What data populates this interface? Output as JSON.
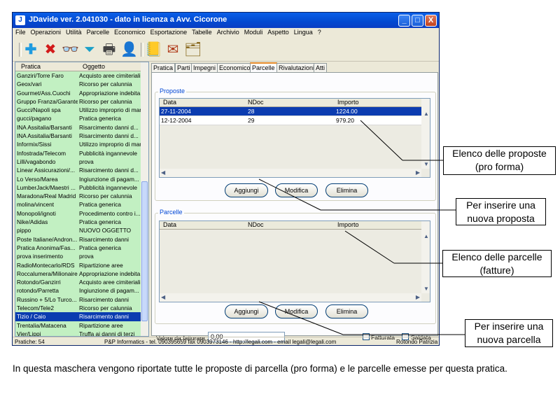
{
  "window": {
    "title": "JDavide ver. 2.041030 - dato in licenza a Avv. Cicorone",
    "app_icon": "J",
    "minimize_glyph": "_",
    "maximize_glyph": "□",
    "close_glyph": "X"
  },
  "menu": [
    "File",
    "Operazioni",
    "Utilità",
    "Parcelle",
    "Economico",
    "Esportazione",
    "Tabelle",
    "Archivio",
    "Moduli",
    "Aspetto",
    "Lingua",
    "?"
  ],
  "toolbar": {
    "icons": [
      "add-icon",
      "delete-icon",
      "search-binoculars-icon",
      "filter-icon",
      "print-icon",
      "help-icon",
      "book-icon",
      "letter-icon",
      "documents-icon"
    ],
    "glyphs": {
      "add": "✚",
      "delete": "✖",
      "binoculars": "👓",
      "filter": "⏷",
      "print": "🖶",
      "help": "👤",
      "book": "📒",
      "letter": "✉",
      "docs": "🗂"
    }
  },
  "list": {
    "headers": {
      "pratica": "Pratica",
      "oggetto": "Oggetto"
    },
    "rows": [
      {
        "pratica": "Ganziri/Torre Faro",
        "oggetto": "Acquisto aree cimiteriali"
      },
      {
        "pratica": "Geox/vari",
        "oggetto": "Ricorso per calunnia"
      },
      {
        "pratica": "Gourmet/Ass.Cuochi",
        "oggetto": "Appropriazione indebita"
      },
      {
        "pratica": "Gruppo Franza/Garante",
        "oggetto": "Ricorso per calunnia"
      },
      {
        "pratica": "Gucci/Napoli spa",
        "oggetto": "Utilizzo improprio di mar..."
      },
      {
        "pratica": "gucci/pagano",
        "oggetto": "Pratica generica"
      },
      {
        "pratica": "INA Assitalia/Barsanti",
        "oggetto": "Risarcimento danni d..."
      },
      {
        "pratica": "INA Assitalia/Barsanti",
        "oggetto": "Risarcimento danni d..."
      },
      {
        "pratica": "Informix/Sissi",
        "oggetto": "Utilizzo improprio di mar..."
      },
      {
        "pratica": "Infostrada/Telecom",
        "oggetto": "Pubblicità ingannevole"
      },
      {
        "pratica": "Lilli/vagabondo",
        "oggetto": "prova"
      },
      {
        "pratica": "Linear Assicurazioni/...",
        "oggetto": "Risarcimento danni d..."
      },
      {
        "pratica": "Lo Verso/Marea",
        "oggetto": "Ingiunzione di pagam..."
      },
      {
        "pratica": "LumberJack/Maestri ...",
        "oggetto": "Pubblicità ingannevole"
      },
      {
        "pratica": "Maradona/Real Madrid",
        "oggetto": "Ricorso per calunnia"
      },
      {
        "pratica": "molina/vincent",
        "oggetto": "Pratica generica"
      },
      {
        "pratica": "Monopoli/ignoti",
        "oggetto": "Procedimento contro i..."
      },
      {
        "pratica": "Nike/Adidas",
        "oggetto": "Pratica generica"
      },
      {
        "pratica": "pippo",
        "oggetto": "NUOVO OGGETTO"
      },
      {
        "pratica": "Poste Italiane/Andron...",
        "oggetto": "Risarcimento danni"
      },
      {
        "pratica": "Pratica Anonima/Fas...",
        "oggetto": "Pratica generica"
      },
      {
        "pratica": "prova inserimento",
        "oggetto": "prova"
      },
      {
        "pratica": "RadioMontecarlo/RDS",
        "oggetto": "Ripartizione aree"
      },
      {
        "pratica": "Roccalumera/Milionaire",
        "oggetto": "Appropriazione indebita"
      },
      {
        "pratica": "Rotondo/Ganzirri",
        "oggetto": "Acquisto aree cimiteriali"
      },
      {
        "pratica": "rotondo/Parretta",
        "oggetto": "Ingiunzione di pagam..."
      },
      {
        "pratica": "Russino + 5/Lo Turco...",
        "oggetto": "Risarcimento danni"
      },
      {
        "pratica": "Telecom/Tele2",
        "oggetto": "Ricorso per calunnia"
      },
      {
        "pratica": "Tizio / Caio",
        "oggetto": "Risarcimento danni"
      },
      {
        "pratica": "Trentalia/Matacena",
        "oggetto": "Ripartizione aree"
      },
      {
        "pratica": "Vier/Lippi",
        "oggetto": "Truffa ai danni di terzi"
      }
    ],
    "selected_index": 28
  },
  "tabs": [
    "Pratica",
    "Parti",
    "Impegni",
    "Economico",
    "Parcelle",
    "Rivalutazioni",
    "Atti"
  ],
  "active_tab": "Parcelle",
  "proposte": {
    "label": "Proposte",
    "headers": {
      "data": "Data",
      "ndoc": "NDoc",
      "importo": "Importo"
    },
    "rows": [
      {
        "data": "27-11-2004",
        "ndoc": "28",
        "importo": "1224.00"
      },
      {
        "data": "12-12-2004",
        "ndoc": "29",
        "importo": "979.20"
      }
    ],
    "buttons": {
      "add": "Aggiungi",
      "edit": "Modifica",
      "delete": "Elimina"
    }
  },
  "parcelle": {
    "label": "Parcelle",
    "headers": {
      "data": "Data",
      "ndoc": "NDoc",
      "importo": "Importo"
    },
    "rows": [],
    "buttons": {
      "add": "Aggiungi",
      "edit": "Modifica",
      "delete": "Elimina"
    }
  },
  "bottom": {
    "valore_label": "Valore da fatturare",
    "valore_value": "0,00",
    "fatturata_label": "Fatturata",
    "saldata_label": "Saldata"
  },
  "statusbar": {
    "count": "Pratiche: 54",
    "contact": "P&P Informatics - tel. 090395659 fax 0903973146 - http://legali.com - email legali@legali.com",
    "user": "Rotondo Patrizia"
  },
  "callouts": {
    "proposte": "Elenco delle proposte (pro forma)",
    "add_proposta": "Per inserire una nuova proposta",
    "parcelle": "Elenco delle parcelle (fatture)",
    "add_parcella": "Per inserire una nuova parcella"
  },
  "caption": "In questa maschera vengono riportate tutte le proposte di parcella (pro forma) e le parcelle emesse per questa pratica."
}
